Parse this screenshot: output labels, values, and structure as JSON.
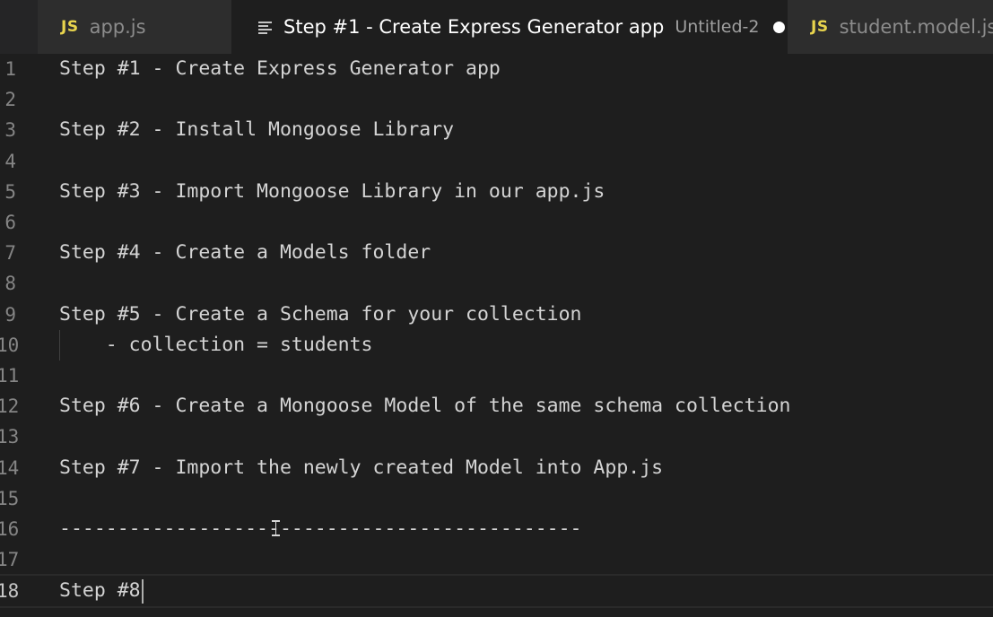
{
  "tabs": [
    {
      "icon": "JS",
      "label": "app.js",
      "active": false
    },
    {
      "label": "Step #1 - Create Express Generator app",
      "description": "Untitled-2",
      "dirty": true,
      "active": true
    },
    {
      "icon": "JS",
      "label": "student.model.js",
      "active": false
    }
  ],
  "editor": {
    "current_line": 18,
    "lines": [
      {
        "n": "1",
        "text": "Step #1 - Create Express Generator app"
      },
      {
        "n": "2",
        "text": ""
      },
      {
        "n": "3",
        "text": "Step #2 - Install Mongoose Library"
      },
      {
        "n": "4",
        "text": ""
      },
      {
        "n": "5",
        "text": "Step #3 - Import Mongoose Library in our app.js"
      },
      {
        "n": "6",
        "text": ""
      },
      {
        "n": "7",
        "text": "Step #4 - Create a Models folder"
      },
      {
        "n": "8",
        "text": ""
      },
      {
        "n": "9",
        "text": "Step #5 - Create a Schema for your collection"
      },
      {
        "n": "10",
        "text": "    - collection = students"
      },
      {
        "n": "11",
        "text": ""
      },
      {
        "n": "12",
        "text": "Step #6 - Create a Mongoose Model of the same schema collection"
      },
      {
        "n": "13",
        "text": ""
      },
      {
        "n": "14",
        "text": "Step #7 - Import the newly created Model into App.js"
      },
      {
        "n": "15",
        "text": ""
      },
      {
        "n": "16",
        "text": "---------------------------------------------"
      },
      {
        "n": "17",
        "text": ""
      },
      {
        "n": "18",
        "text": "Step #8"
      }
    ]
  },
  "colors": {
    "editor_bg": "#1e1e1e",
    "tab_bar_bg": "#252526",
    "inactive_tab_bg": "#2d2d2d",
    "js_icon": "#e8d44d",
    "text": "#d4d4d4",
    "line_number": "#858585"
  }
}
